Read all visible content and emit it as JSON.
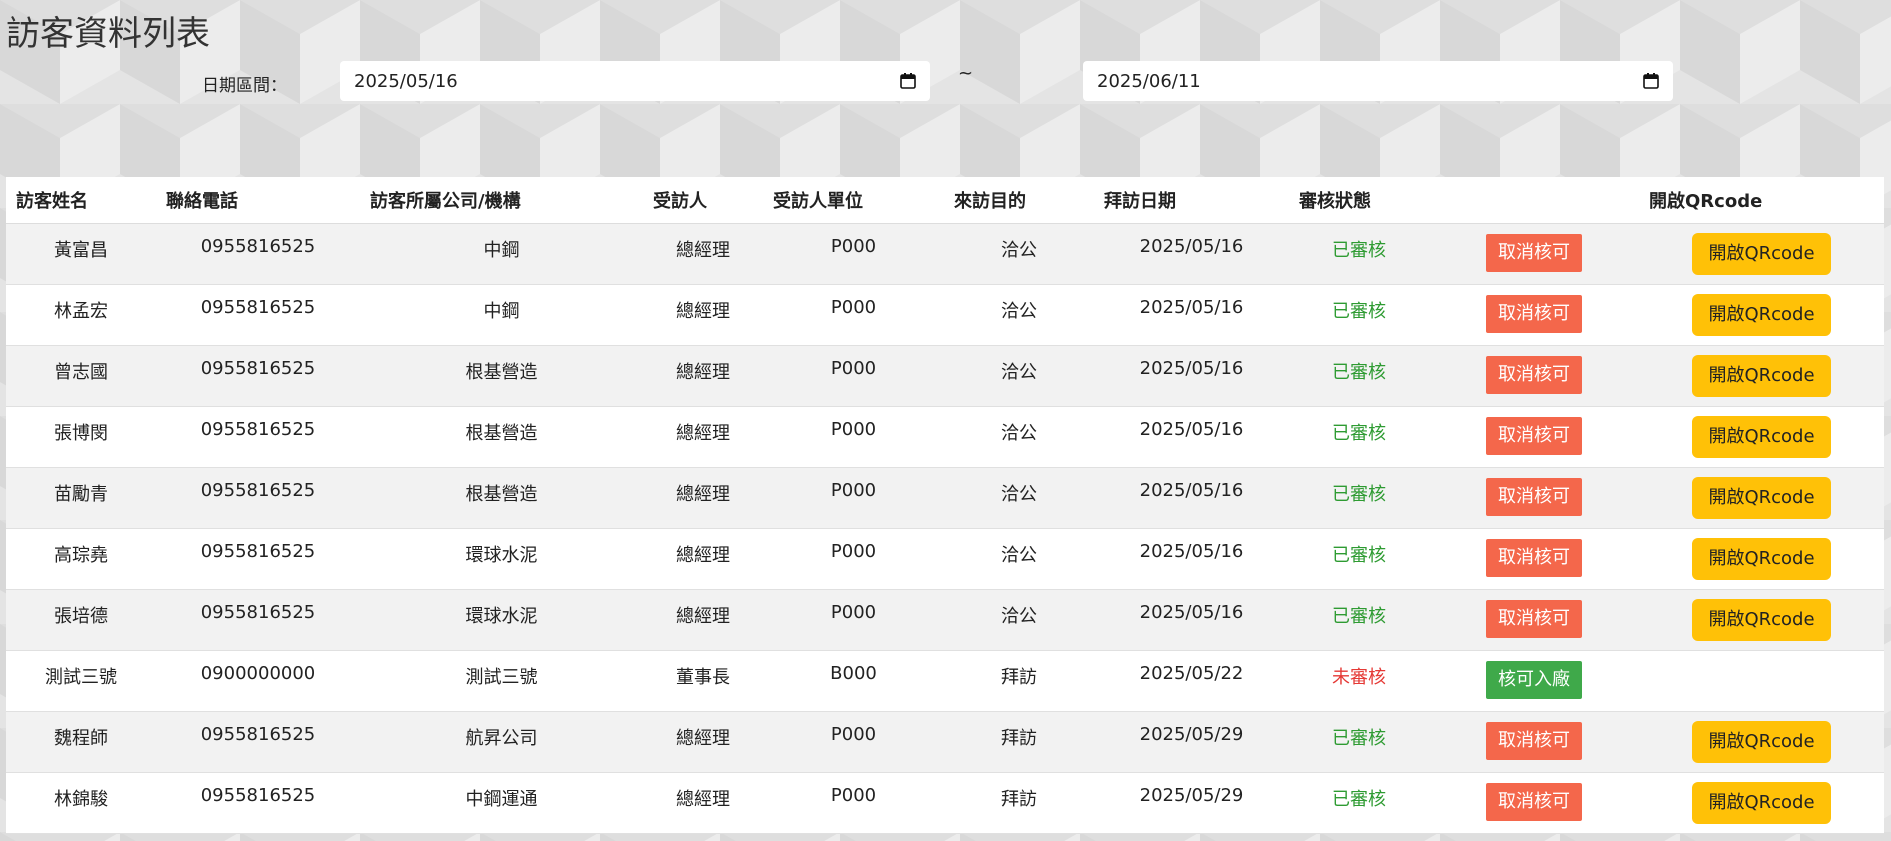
{
  "page": {
    "title": "訪客資料列表"
  },
  "filter": {
    "label": "日期區間：",
    "start_date": "2025/05/16",
    "separator": "~",
    "end_date": "2025/06/11",
    "calendar_icon": "calendar-icon"
  },
  "colors": {
    "approved_status": "#2e9b32",
    "pending_status": "#e53935",
    "cancel_button": "#f4674b",
    "approve_button": "#3fa94a",
    "qr_button": "#ffc107"
  },
  "table": {
    "headers": [
      "訪客姓名",
      "聯絡電話",
      "訪客所屬公司/機構",
      "受訪人",
      "受訪人單位",
      "來訪目的",
      "拜訪日期",
      "審核狀態",
      "",
      "開啟QRcode"
    ],
    "rows": [
      {
        "name": "黃富昌",
        "phone": "0955816525",
        "company": "中鋼",
        "host": "總經理",
        "unit": "P000",
        "purpose": "洽公",
        "date": "2025/05/16",
        "status": "已審核",
        "action": "取消核可",
        "qr": "開啟QRcode"
      },
      {
        "name": "林孟宏",
        "phone": "0955816525",
        "company": "中鋼",
        "host": "總經理",
        "unit": "P000",
        "purpose": "洽公",
        "date": "2025/05/16",
        "status": "已審核",
        "action": "取消核可",
        "qr": "開啟QRcode"
      },
      {
        "name": "曾志國",
        "phone": "0955816525",
        "company": "根基營造",
        "host": "總經理",
        "unit": "P000",
        "purpose": "洽公",
        "date": "2025/05/16",
        "status": "已審核",
        "action": "取消核可",
        "qr": "開啟QRcode"
      },
      {
        "name": "張博閔",
        "phone": "0955816525",
        "company": "根基營造",
        "host": "總經理",
        "unit": "P000",
        "purpose": "洽公",
        "date": "2025/05/16",
        "status": "已審核",
        "action": "取消核可",
        "qr": "開啟QRcode"
      },
      {
        "name": "苗勵青",
        "phone": "0955816525",
        "company": "根基營造",
        "host": "總經理",
        "unit": "P000",
        "purpose": "洽公",
        "date": "2025/05/16",
        "status": "已審核",
        "action": "取消核可",
        "qr": "開啟QRcode"
      },
      {
        "name": "高琮堯",
        "phone": "0955816525",
        "company": "環球水泥",
        "host": "總經理",
        "unit": "P000",
        "purpose": "洽公",
        "date": "2025/05/16",
        "status": "已審核",
        "action": "取消核可",
        "qr": "開啟QRcode"
      },
      {
        "name": "張培德",
        "phone": "0955816525",
        "company": "環球水泥",
        "host": "總經理",
        "unit": "P000",
        "purpose": "洽公",
        "date": "2025/05/16",
        "status": "已審核",
        "action": "取消核可",
        "qr": "開啟QRcode"
      },
      {
        "name": "測試三號",
        "phone": "0900000000",
        "company": "測試三號",
        "host": "董事長",
        "unit": "B000",
        "purpose": "拜訪",
        "date": "2025/05/22",
        "status": "未審核",
        "action": "核可入廠",
        "qr": ""
      },
      {
        "name": "魏程師",
        "phone": "0955816525",
        "company": "航昇公司",
        "host": "總經理",
        "unit": "P000",
        "purpose": "拜訪",
        "date": "2025/05/29",
        "status": "已審核",
        "action": "取消核可",
        "qr": "開啟QRcode"
      },
      {
        "name": "林錦駿",
        "phone": "0955816525",
        "company": "中鋼運通",
        "host": "總經理",
        "unit": "P000",
        "purpose": "拜訪",
        "date": "2025/05/29",
        "status": "已審核",
        "action": "取消核可",
        "qr": "開啟QRcode"
      }
    ]
  }
}
